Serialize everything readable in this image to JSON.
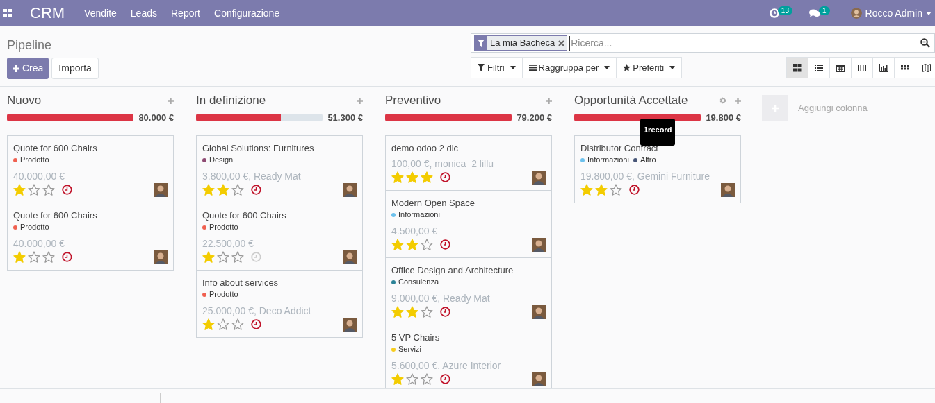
{
  "navbar": {
    "app_name": "CRM",
    "menu": [
      "Vendite",
      "Leads",
      "Report",
      "Configurazione"
    ],
    "activity_count": "13",
    "message_count": "1",
    "user": "Rocco Admin"
  },
  "control_panel": {
    "title": "Pipeline",
    "create_label": "Crea",
    "import_label": "Importa",
    "facet": "La mia Bacheca",
    "search_placeholder": "Ricerca...",
    "filters": [
      {
        "kind": "filter",
        "label": "Filtri"
      },
      {
        "kind": "group",
        "label": "Raggruppa per"
      },
      {
        "kind": "favorite",
        "label": "Preferiti"
      }
    ],
    "views": [
      {
        "kind": "kanban",
        "selected": true
      },
      {
        "kind": "list",
        "selected": false
      },
      {
        "kind": "calendar",
        "selected": false
      },
      {
        "kind": "pivot",
        "selected": false
      },
      {
        "kind": "graph",
        "selected": false
      },
      {
        "kind": "grid",
        "selected": false
      },
      {
        "kind": "map",
        "selected": false
      }
    ]
  },
  "columns": [
    {
      "title": "Nuovo",
      "level": 1,
      "total": "80.000",
      "currency": "€",
      "settings": false,
      "cards": [
        {
          "name": "Quote for 600 Chairs",
          "tags": [
            {
              "label": "Prodotto",
              "color": "#f06050"
            }
          ],
          "amount": "40.000,00 €",
          "stars": 1,
          "activity_overdue": true
        },
        {
          "name": "Quote for 600 Chairs",
          "tags": [
            {
              "label": "Prodotto",
              "color": "#f06050"
            }
          ],
          "amount": "40.000,00 €",
          "stars": 1,
          "activity_overdue": true
        }
      ]
    },
    {
      "title": "In definizione",
      "level": 0.67,
      "total": "51.300",
      "currency": "€",
      "settings": false,
      "cards": [
        {
          "name": "Global Solutions: Furnitures",
          "tags": [
            {
              "label": "Design",
              "color": "#8e4a72"
            }
          ],
          "amount": "3.800,00 €, Ready Mat",
          "stars": 2,
          "activity_overdue": true
        },
        {
          "name": "Quote for 600 Chairs",
          "tags": [
            {
              "label": "Prodotto",
              "color": "#f06050"
            }
          ],
          "amount": "22.500,00 €",
          "stars": 1,
          "activity_overdue": false
        },
        {
          "name": "Info about services",
          "tags": [
            {
              "label": "Prodotto",
              "color": "#f06050"
            }
          ],
          "amount": "25.000,00 €, Deco Addict",
          "stars": 1,
          "activity_overdue": true
        }
      ]
    },
    {
      "title": "Preventivo",
      "level": 1,
      "total": "79.200",
      "currency": "€",
      "settings": false,
      "cards": [
        {
          "name": "demo odoo 2 dic",
          "amount": "100,00 €, monica_2 lillu",
          "stars": 3,
          "activity_overdue": true
        },
        {
          "name": "Modern Open Space",
          "tags": [
            {
              "label": "Informazioni",
              "color": "#6cc1ed"
            }
          ],
          "amount": "4.500,00 €",
          "stars": 2,
          "activity_overdue": true
        },
        {
          "name": "Office Design and Architecture",
          "tags": [
            {
              "label": "Consulenza",
              "color": "#2c8397"
            }
          ],
          "amount": "9.000,00 €, Ready Mat",
          "stars": 2,
          "activity_overdue": true
        },
        {
          "name": "5 VP Chairs",
          "tags": [
            {
              "label": "Servizi",
              "color": "#f7cd1f"
            }
          ],
          "amount": "5.600,00 €, Azure Interior",
          "stars": 1,
          "activity_overdue": true
        }
      ]
    },
    {
      "title": "Opportunità Accettate",
      "level": 1,
      "total": "19.800",
      "currency": "€",
      "settings": true,
      "tooltip": "1record",
      "cards": [
        {
          "name": "Distributor Contract",
          "tags": [
            {
              "label": "Informazioni",
              "color": "#6cc1ed"
            },
            {
              "label": "Altro",
              "color": "#475577"
            }
          ],
          "amount": "19.800,00 €, Gemini Furniture",
          "stars": 2,
          "activity_overdue": true
        }
      ]
    }
  ],
  "add_column": "Aggiungi colonna"
}
